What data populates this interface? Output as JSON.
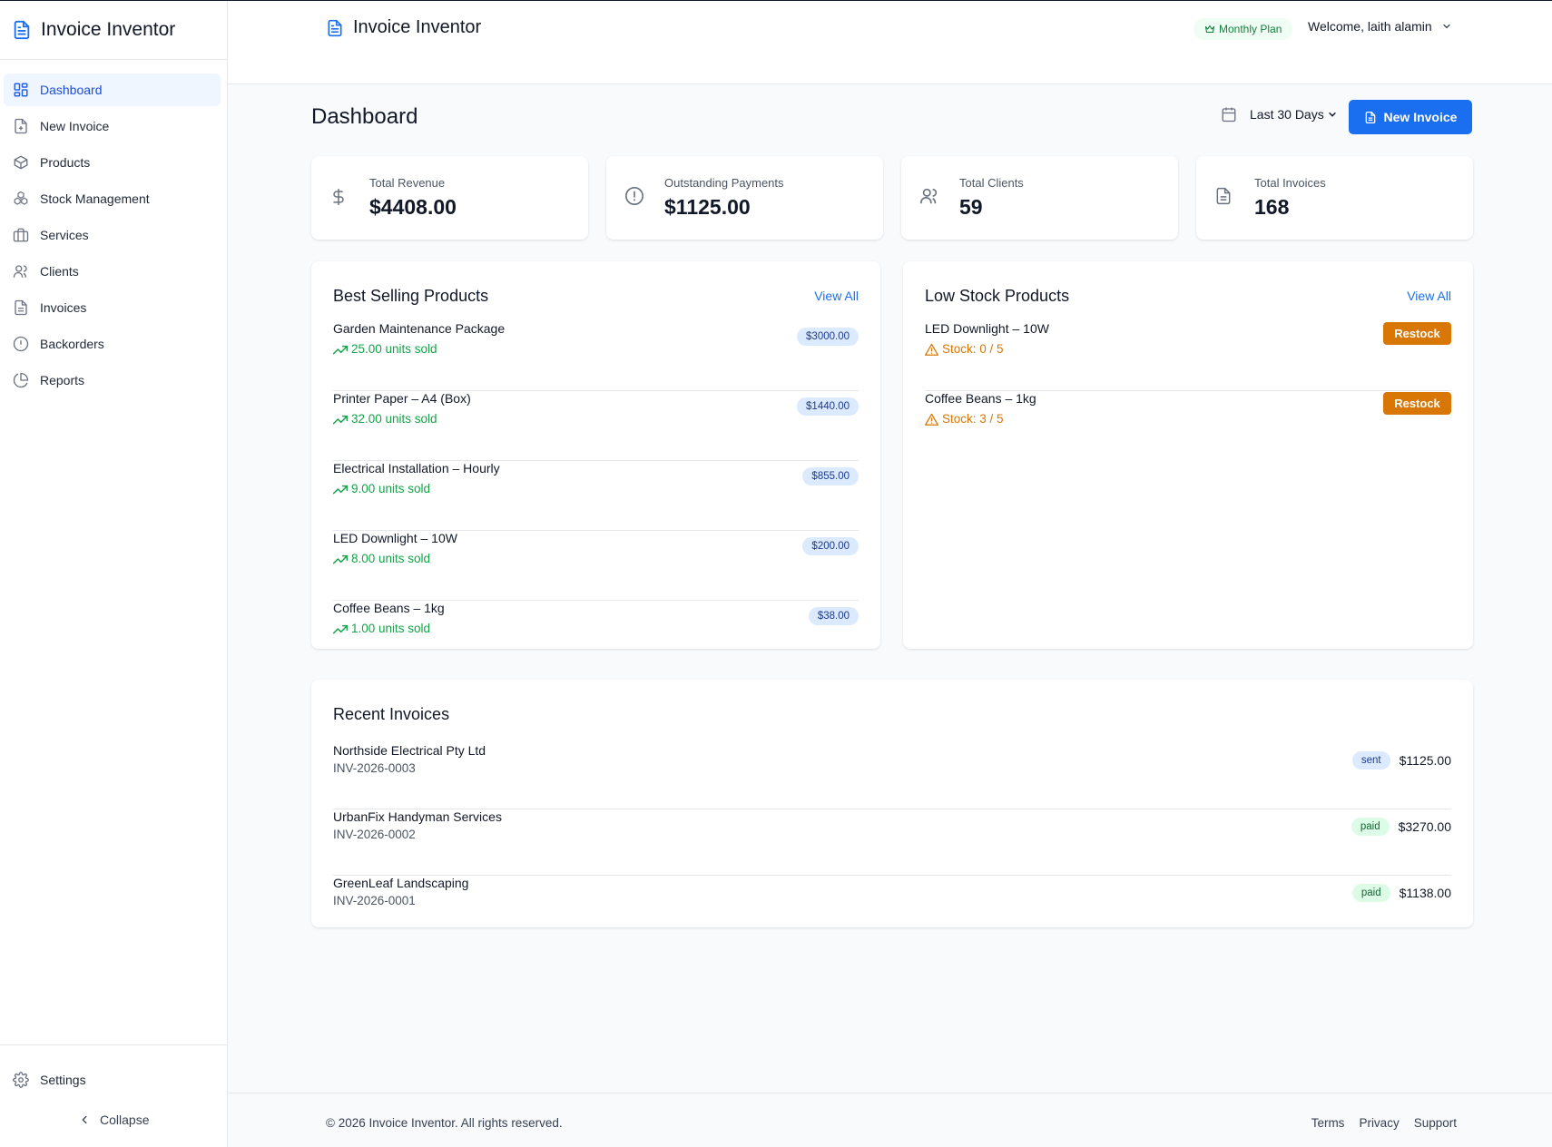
{
  "app": {
    "name": "Invoice Inventor"
  },
  "sidebar": {
    "items": [
      {
        "label": "Dashboard",
        "icon": "grid-icon"
      },
      {
        "label": "New Invoice",
        "icon": "file-plus-icon"
      },
      {
        "label": "Products",
        "icon": "box-icon"
      },
      {
        "label": "Stock Management",
        "icon": "boxes-icon"
      },
      {
        "label": "Services",
        "icon": "briefcase-icon"
      },
      {
        "label": "Clients",
        "icon": "users-icon"
      },
      {
        "label": "Invoices",
        "icon": "file-text-icon"
      },
      {
        "label": "Backorders",
        "icon": "alert-circle-icon"
      },
      {
        "label": "Reports",
        "icon": "pie-chart-icon"
      }
    ],
    "settings_label": "Settings",
    "collapse_label": "Collapse"
  },
  "header": {
    "plan_label": "Monthly Plan",
    "welcome_label": "Welcome, laith alamin"
  },
  "dashboard": {
    "title": "Dashboard",
    "date_range": "Last 30 Days",
    "new_invoice_label": "New Invoice",
    "stats": [
      {
        "label": "Total Revenue",
        "value": "$4408.00",
        "icon": "dollar-icon"
      },
      {
        "label": "Outstanding Payments",
        "value": "$1125.00",
        "icon": "clock-alert-icon"
      },
      {
        "label": "Total Clients",
        "value": "59",
        "icon": "users-icon"
      },
      {
        "label": "Total Invoices",
        "value": "168",
        "icon": "file-text-icon"
      }
    ],
    "best_selling": {
      "title": "Best Selling Products",
      "view_all": "View All",
      "items": [
        {
          "name": "Garden Maintenance Package",
          "sold": "25.00 units sold",
          "amount": "$3000.00"
        },
        {
          "name": "Printer Paper – A4 (Box)",
          "sold": "32.00 units sold",
          "amount": "$1440.00"
        },
        {
          "name": "Electrical Installation – Hourly",
          "sold": "9.00 units sold",
          "amount": "$855.00"
        },
        {
          "name": "LED Downlight – 10W",
          "sold": "8.00 units sold",
          "amount": "$200.00"
        },
        {
          "name": "Coffee Beans – 1kg",
          "sold": "1.00 units sold",
          "amount": "$38.00"
        }
      ]
    },
    "low_stock": {
      "title": "Low Stock Products",
      "view_all": "View All",
      "restock_label": "Restock",
      "items": [
        {
          "name": "LED Downlight – 10W",
          "stock": "Stock: 0 / 5"
        },
        {
          "name": "Coffee Beans – 1kg",
          "stock": "Stock: 3 / 5"
        }
      ]
    },
    "recent_invoices": {
      "title": "Recent Invoices",
      "items": [
        {
          "client": "Northside Electrical Pty Ltd",
          "number": "INV-2026-0003",
          "status": "sent",
          "amount": "$1125.00"
        },
        {
          "client": "UrbanFix Handyman Services",
          "number": "INV-2026-0002",
          "status": "paid",
          "amount": "$3270.00"
        },
        {
          "client": "GreenLeaf Landscaping",
          "number": "INV-2026-0001",
          "status": "paid",
          "amount": "$1138.00"
        }
      ]
    }
  },
  "footer": {
    "copyright": "© 2026 Invoice Inventor. All rights reserved.",
    "links": [
      "Terms",
      "Privacy",
      "Support"
    ]
  },
  "colors": {
    "primary": "#1a6ef0",
    "active_bg": "#eff6ff",
    "success": "#16a34a",
    "warning": "#d97706",
    "pill_blue": "#dbeafe",
    "pill_green": "#dcfce7"
  }
}
